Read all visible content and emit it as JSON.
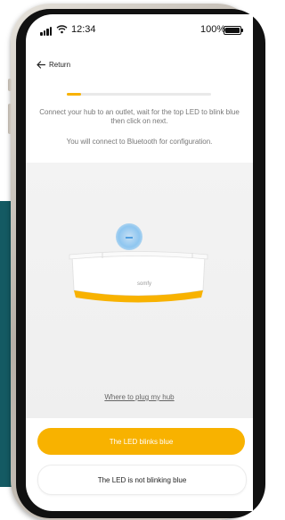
{
  "status_bar": {
    "time": "12:34",
    "battery": "100%"
  },
  "header": {
    "return_label": "Return"
  },
  "progress": {
    "fraction": 0.1
  },
  "content": {
    "instruction": "Connect your hub to an outlet, wait for the top LED to blink blue then click on next.",
    "bluetooth_note": "You will connect to Bluetooth for configuration.",
    "brand": "somfy",
    "where_link": "Where to plug my hub"
  },
  "actions": {
    "primary_label": "The LED blinks blue",
    "secondary_label": "The LED is not blinking blue"
  },
  "colors": {
    "accent": "#f8b200",
    "led": "#8ec6f0",
    "teal": "#145a63"
  }
}
